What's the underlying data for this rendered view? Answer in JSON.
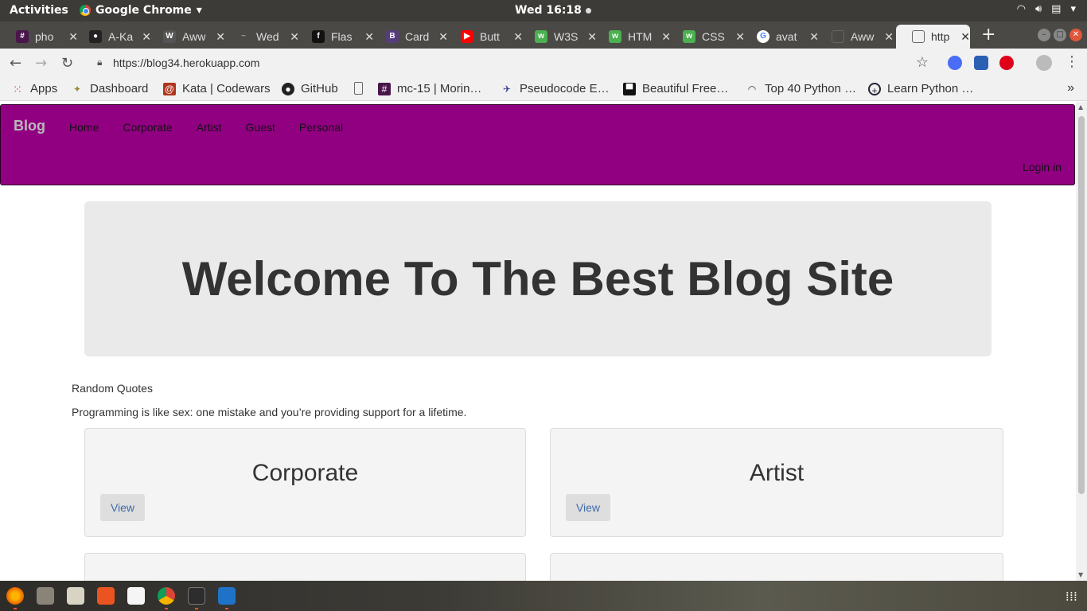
{
  "desktop": {
    "activities": "Activities",
    "app_name": "Google Chrome",
    "clock": "Wed 16:18"
  },
  "browser": {
    "tabs": [
      {
        "title": "pho",
        "favicon": "slack-icon",
        "color": "#4a154b"
      },
      {
        "title": "A-Ka",
        "favicon": "github-icon",
        "color": "#222222"
      },
      {
        "title": "Aww",
        "favicon": "awwwards-icon",
        "color": "#555555"
      },
      {
        "title": "Wed",
        "favicon": "generic-icon",
        "color": "#555555"
      },
      {
        "title": "Flas",
        "favicon": "flask-icon",
        "color": "#111111"
      },
      {
        "title": "Card",
        "favicon": "bootstrap-icon",
        "color": "#563d7c"
      },
      {
        "title": "Butt",
        "favicon": "youtube-icon",
        "color": "#ff0000"
      },
      {
        "title": "W3S",
        "favicon": "w3schools-icon",
        "color": "#4caf50"
      },
      {
        "title": "HTM",
        "favicon": "w3schools-icon",
        "color": "#4caf50"
      },
      {
        "title": "CSS",
        "favicon": "w3schools-icon",
        "color": "#4caf50"
      },
      {
        "title": "avat",
        "favicon": "google-icon",
        "color": "#ffffff"
      },
      {
        "title": "Aww",
        "favicon": "document-icon",
        "color": "#666666"
      },
      {
        "title": "http",
        "favicon": "document-icon",
        "color": "#666666",
        "active": true
      }
    ],
    "url": "https://blog34.herokuapp.com",
    "bookmarks": [
      {
        "label": "Apps",
        "icon": "apps-grid-icon"
      },
      {
        "label": "Dashboard",
        "icon": "dashboard-icon"
      },
      {
        "label": "Kata | Codewars",
        "icon": "codewars-icon"
      },
      {
        "label": "GitHub",
        "icon": "github-icon"
      },
      {
        "label": "",
        "icon": "document-icon"
      },
      {
        "label": "mc-15 | Morin…",
        "icon": "slack-icon"
      },
      {
        "label": "Pseudocode E…",
        "icon": "bird-icon"
      },
      {
        "label": "Beautiful Free…",
        "icon": "unsplash-icon"
      },
      {
        "label": "Top 40 Python …",
        "icon": "bookmark-icon"
      },
      {
        "label": "Learn Python …",
        "icon": "python-icon"
      }
    ]
  },
  "site": {
    "brand": "Blog",
    "nav": [
      "Home",
      "Corporate",
      "Artist",
      "Guest",
      "Personal"
    ],
    "login": "Login in",
    "hero_title": "Welcome To The Best Blog Site",
    "quotes_label": "Random Quotes",
    "quote": "Programming is like sex: one mistake and you’re providing support for a lifetime.",
    "cards": [
      {
        "title": "Corporate",
        "button": "View"
      },
      {
        "title": "Artist",
        "button": "View"
      }
    ],
    "colors": {
      "navbar": "#920082",
      "hero": "#eaeaea",
      "card": "#f4f4f4"
    }
  }
}
